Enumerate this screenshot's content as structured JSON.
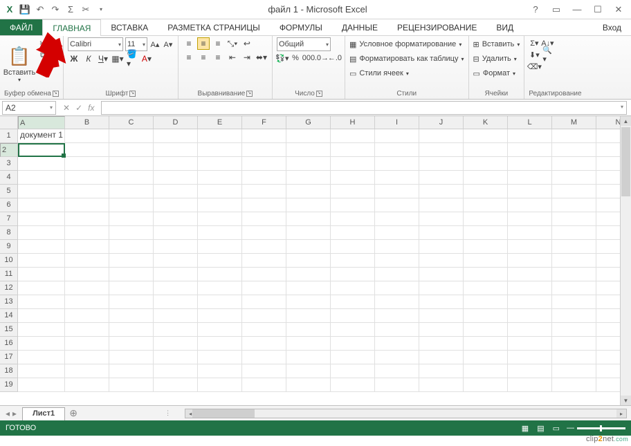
{
  "title": "файл 1 - Microsoft Excel",
  "qat": {
    "excel": "X",
    "save": "💾",
    "undo": "↶",
    "redo": "↷",
    "sum": "Σ",
    "cut": "✂"
  },
  "tabs": {
    "file": "ФАЙЛ",
    "items": [
      "ГЛАВНАЯ",
      "ВСТАВКА",
      "РАЗМЕТКА СТРАНИЦЫ",
      "ФОРМУЛЫ",
      "ДАННЫЕ",
      "РЕЦЕНЗИРОВАНИЕ",
      "ВИД"
    ],
    "login": "Вход"
  },
  "ribbon": {
    "clipboard": {
      "paste": "Вставить",
      "label": "Буфер обмена"
    },
    "font": {
      "name": "Calibri",
      "size": "11",
      "label": "Шрифт"
    },
    "align": {
      "label": "Выравнивание"
    },
    "number": {
      "format": "Общий",
      "label": "Число"
    },
    "styles": {
      "cond": "Условное форматирование",
      "table": "Форматировать как таблицу",
      "cell": "Стили ячеек",
      "label": "Стили"
    },
    "cells": {
      "insert": "Вставить",
      "delete": "Удалить",
      "format": "Формат",
      "label": "Ячейки"
    },
    "edit": {
      "label": "Редактирование"
    }
  },
  "namebox": "A2",
  "columns": [
    "A",
    "B",
    "C",
    "D",
    "E",
    "F",
    "G",
    "H",
    "I",
    "J",
    "K",
    "L",
    "M",
    "N"
  ],
  "rows": 19,
  "cellA1": "документ 1",
  "sheet": {
    "name": "Лист1"
  },
  "status": "ГОТОВО",
  "watermark": {
    "a": "clip",
    "b": "2",
    "c": "net",
    "d": ".com"
  }
}
